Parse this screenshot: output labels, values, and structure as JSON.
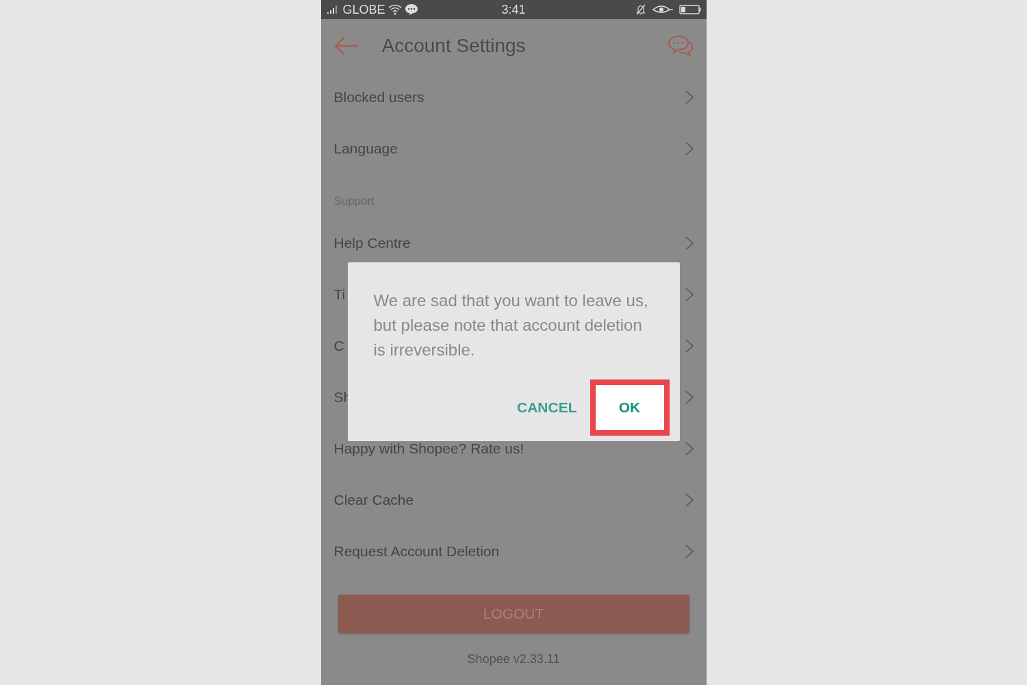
{
  "status_bar": {
    "carrier": "GLOBE",
    "time": "3:41"
  },
  "header": {
    "title": "Account Settings"
  },
  "menu": [
    {
      "kind": "item",
      "label": "Blocked users"
    },
    {
      "kind": "item",
      "label": "Language"
    },
    {
      "kind": "section",
      "label": "Support"
    },
    {
      "kind": "item",
      "label": "Help Centre"
    },
    {
      "kind": "item",
      "label": "Ti"
    },
    {
      "kind": "item",
      "label": "C"
    },
    {
      "kind": "item",
      "label": "Sh"
    },
    {
      "kind": "item",
      "label": "Happy with Shopee? Rate us!"
    },
    {
      "kind": "item",
      "label": "Clear Cache"
    },
    {
      "kind": "item",
      "label": "Request Account Deletion"
    }
  ],
  "logout_button": "LOGOUT",
  "version": "Shopee v2.33.11",
  "dialog": {
    "message": "We are sad that you want to leave us, but please note that account deletion is irreversible.",
    "buttons": [
      {
        "label": "CANCEL",
        "highlighted": false
      },
      {
        "label": "OK",
        "highlighted": true
      }
    ]
  }
}
